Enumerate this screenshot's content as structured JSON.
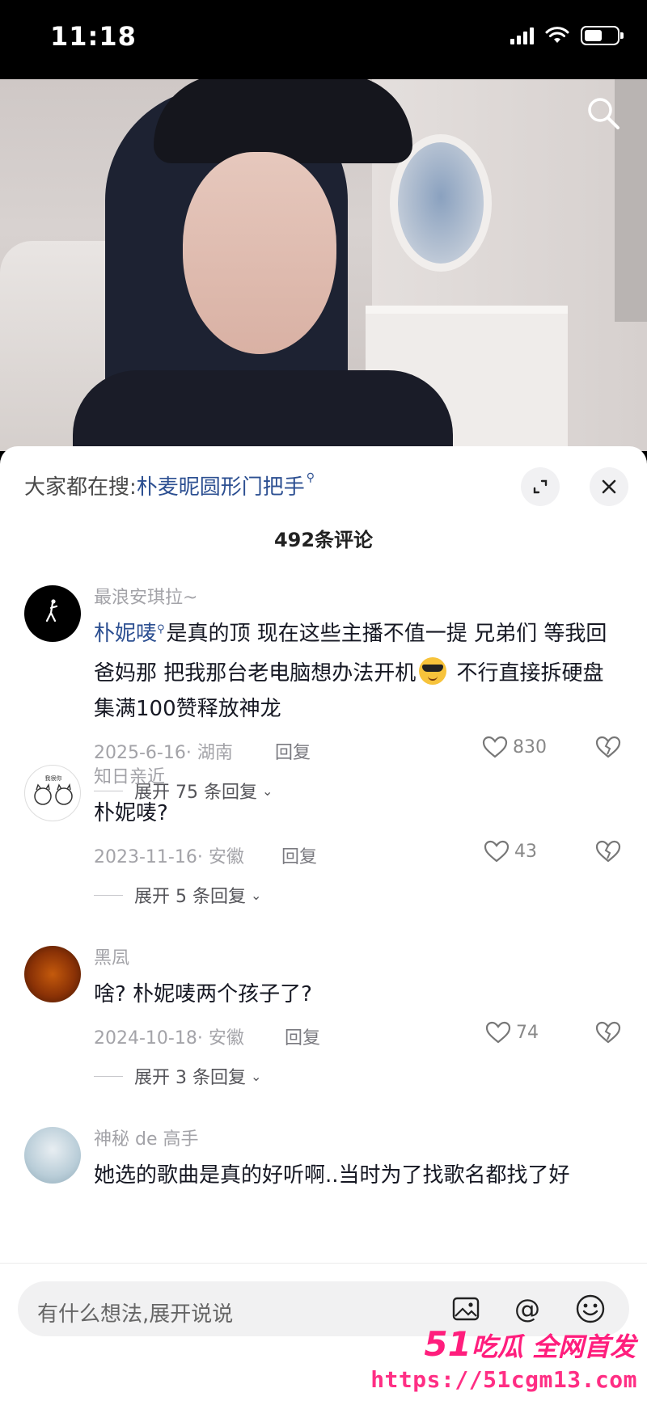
{
  "status_bar": {
    "time": "11:18"
  },
  "header": {
    "trend_prefix": "大家都在搜:",
    "trend_query": "朴麦昵圆形门把手",
    "comment_count": "492条评论"
  },
  "comments": [
    {
      "user": "最浪安琪拉~",
      "mention": "朴妮唛",
      "text_before_emoji": "是真的顶 现在这些主播不值一提 兄弟们 等我回爸妈那 把我那台老电脑想办法开机",
      "text_after_emoji": " 不行直接拆硬盘 集满100赞释放神龙",
      "date": "2025-6-16· 湖南",
      "reply": "回复",
      "likes": "830",
      "expand": "展开 75 条回复"
    },
    {
      "user": "知日亲近",
      "text": "朴妮唛?",
      "date": "2023-11-16· 安徽",
      "reply": "回复",
      "likes": "43",
      "expand": "展开 5 条回复"
    },
    {
      "user": "黑凨",
      "text": "啥? 朴妮唛两个孩子了?",
      "date": "2024-10-18· 安徽",
      "reply": "回复",
      "likes": "74",
      "expand": "展开 3 条回复"
    },
    {
      "user": "神秘 de 高手",
      "text": "她选的歌曲是真的好听啊..当时为了找歌名都找了好"
    }
  ],
  "input": {
    "placeholder": "有什么想法,展开说说"
  },
  "watermark": {
    "brand_num": "51",
    "brand_text": "吃瓜 全网首发",
    "url": "https://51cgm13.com"
  },
  "colors": {
    "link": "#2c4f91",
    "watermark": "#ff1e7d"
  }
}
